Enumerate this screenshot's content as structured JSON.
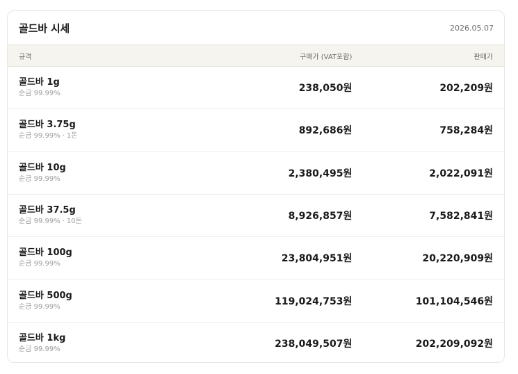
{
  "header": {
    "title": "골드바 시세",
    "date": "2026.05.07"
  },
  "columns": {
    "spec": "규격",
    "buy": "구매가 (VAT포함)",
    "sell": "판매가"
  },
  "rows": [
    {
      "name": "골드바 1g",
      "purity": "순금 99.99%",
      "extra": "",
      "buy": "238,050원",
      "sell": "202,209원"
    },
    {
      "name": "골드바 3.75g",
      "purity": "순금 99.99%",
      "extra": "1돈",
      "buy": "892,686원",
      "sell": "758,284원"
    },
    {
      "name": "골드바 10g",
      "purity": "순금 99.99%",
      "extra": "",
      "buy": "2,380,495원",
      "sell": "2,022,091원"
    },
    {
      "name": "골드바 37.5g",
      "purity": "순금 99.99%",
      "extra": "10돈",
      "buy": "8,926,857원",
      "sell": "7,582,841원"
    },
    {
      "name": "골드바 100g",
      "purity": "순금 99.99%",
      "extra": "",
      "buy": "23,804,951원",
      "sell": "20,220,909원"
    },
    {
      "name": "골드바 500g",
      "purity": "순금 99.99%",
      "extra": "",
      "buy": "119,024,753원",
      "sell": "101,104,546원"
    },
    {
      "name": "골드바 1kg",
      "purity": "순금 99.99%",
      "extra": "",
      "buy": "238,049,507원",
      "sell": "202,209,092원"
    }
  ]
}
